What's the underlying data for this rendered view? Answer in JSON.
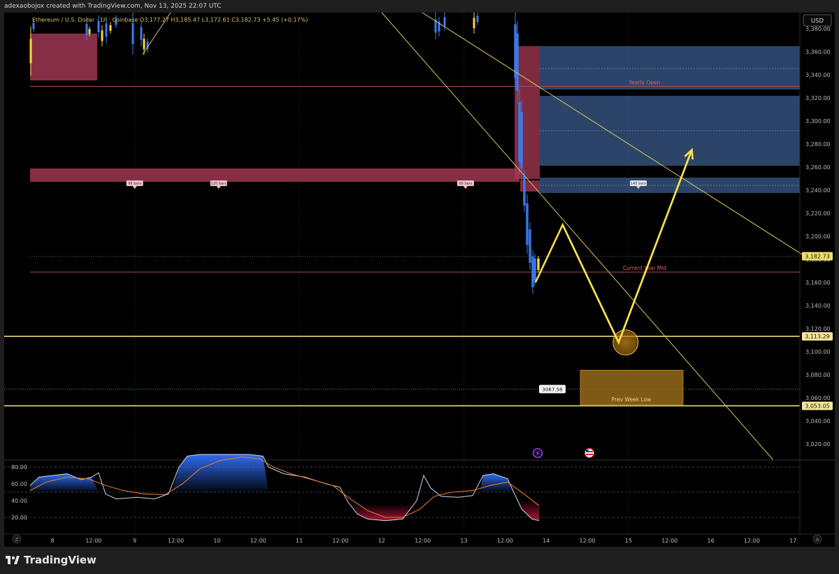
{
  "header": {
    "attribution": "adexaobojox created with TradingView.com, Nov 13, 2025 22:07 UTC",
    "legend": "Ethereum / U.S. Dollar · 1h · Coinbase  O3,177.27  H3,185.47  L3,172.61  C3,182.73  +5.45 (+0.17%)",
    "currency_button": "USD"
  },
  "chart_data": {
    "type": "candlestick",
    "symbol": "Ethereum / U.S. Dollar",
    "interval": "1h",
    "exchange": "Coinbase",
    "ohlc": {
      "open": 3177.27,
      "high": 3185.47,
      "low": 3172.61,
      "close": 3182.73,
      "change": 5.45,
      "change_pct": 0.17
    },
    "y_axis": {
      "range": [
        3008,
        3385
      ],
      "ticks": [
        "3,020.00",
        "3,040.00",
        "3,060.00",
        "3,080.00",
        "3,100.00",
        "3,120.00",
        "3,140.00",
        "3,160.00",
        "3,180.00",
        "3,200.00",
        "3,220.00",
        "3,240.00",
        "3,260.00",
        "3,280.00",
        "3,300.00",
        "3,320.00",
        "3,340.00",
        "3,360.00",
        "3,380.00"
      ]
    },
    "x_axis": {
      "ticks": [
        {
          "label": "8",
          "day": 0.0
        },
        {
          "label": "12:00",
          "day": 0.5
        },
        {
          "label": "9",
          "day": 1.0
        },
        {
          "label": "12:00",
          "day": 1.5
        },
        {
          "label": "10",
          "day": 2.0
        },
        {
          "label": "12:00",
          "day": 2.5
        },
        {
          "label": "11",
          "day": 3.0
        },
        {
          "label": "12:00",
          "day": 3.5
        },
        {
          "label": "12",
          "day": 4.0
        },
        {
          "label": "12:00",
          "day": 4.5
        },
        {
          "label": "13",
          "day": 5.0
        },
        {
          "label": "12:00",
          "day": 5.5
        },
        {
          "label": "14",
          "day": 6.0
        },
        {
          "label": "12:00",
          "day": 6.5
        },
        {
          "label": "15",
          "day": 7.0
        },
        {
          "label": "12:00",
          "day": 7.5
        },
        {
          "label": "16",
          "day": 8.0
        },
        {
          "label": "12:00",
          "day": 8.5
        },
        {
          "label": "17",
          "day": 9.0
        }
      ]
    },
    "price_labels": [
      {
        "text": "3,182.73",
        "price": 3182.73,
        "style": "current"
      },
      {
        "text": "3,113.29",
        "price": 3113.29,
        "style": "yellow"
      },
      {
        "text": "3,053.05",
        "price": 3053.05,
        "style": "yellow"
      }
    ],
    "levels": [
      {
        "name": "Yearly Open",
        "price": 3330,
        "color": "#b04a4a"
      },
      {
        "name": "Current Year Mid",
        "price": 3169,
        "color": "#b04a4a"
      }
    ],
    "flags": [
      {
        "text": "96 bars",
        "day": 1.0
      },
      {
        "text": "120 bars",
        "day": 2.02
      },
      {
        "text": "96 bars",
        "day": 5.02
      },
      {
        "text": "145 bars",
        "day": 7.12
      }
    ],
    "marker": {
      "text": "3067.58",
      "price": 3067.58
    },
    "zones": [
      {
        "name": "Prev Week Low",
        "price_top": 3084,
        "price_bottom": 3054
      }
    ],
    "projection": [
      {
        "day": 5.87,
        "price": 3160
      },
      {
        "day": 6.2,
        "price": 3210
      },
      {
        "day": 6.88,
        "price": 3108
      },
      {
        "day": 7.77,
        "price": 3275
      }
    ],
    "oscillator": {
      "ticks": [
        "80.00",
        "60.00",
        "40.00",
        "20.00"
      ],
      "range": [
        10,
        95
      ],
      "levels": [
        80,
        50,
        20
      ]
    }
  },
  "footer": {
    "brand": "TradingView",
    "left_button": "Z",
    "right_button": "A"
  },
  "colors": {
    "bull": "#f5d84a",
    "bear": "#3d7bf0",
    "accent_yellow": "#f7e14b",
    "red_zone": "#a83a56",
    "blue_zone": "#3b5b8a"
  }
}
